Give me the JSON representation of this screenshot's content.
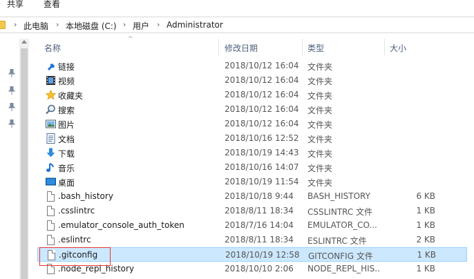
{
  "ribbon": {
    "tabs": [
      "共享",
      "查看"
    ]
  },
  "address": {
    "crumbs": [
      "此电脑",
      "本地磁盘 (C:)",
      "用户",
      "Administrator"
    ]
  },
  "columns": {
    "name": "名称",
    "date": "修改日期",
    "type": "类型",
    "size": "大小"
  },
  "files": [
    {
      "name": "链接",
      "date": "2018/10/12 16:04",
      "type": "文件夹",
      "size": "",
      "icon": "link-folder-icon"
    },
    {
      "name": "视频",
      "date": "2018/10/12 16:04",
      "type": "文件夹",
      "size": "",
      "icon": "video-folder-icon"
    },
    {
      "name": "收藏夹",
      "date": "2018/10/12 16:04",
      "type": "文件夹",
      "size": "",
      "icon": "star-folder-icon"
    },
    {
      "name": "搜索",
      "date": "2018/10/12 16:04",
      "type": "文件夹",
      "size": "",
      "icon": "search-folder-icon"
    },
    {
      "name": "图片",
      "date": "2018/10/12 16:04",
      "type": "文件夹",
      "size": "",
      "icon": "pictures-folder-icon"
    },
    {
      "name": "文档",
      "date": "2018/10/16 12:52",
      "type": "文件夹",
      "size": "",
      "icon": "documents-folder-icon"
    },
    {
      "name": "下载",
      "date": "2018/10/19 14:43",
      "type": "文件夹",
      "size": "",
      "icon": "downloads-folder-icon"
    },
    {
      "name": "音乐",
      "date": "2018/10/16 14:07",
      "type": "文件夹",
      "size": "",
      "icon": "music-folder-icon"
    },
    {
      "name": "桌面",
      "date": "2018/10/19 11:54",
      "type": "文件夹",
      "size": "",
      "icon": "desktop-folder-icon"
    },
    {
      "name": ".bash_history",
      "date": "2018/10/18 9:44",
      "type": "BASH_HISTORY",
      "size": "6 KB",
      "icon": "file-icon"
    },
    {
      "name": ".csslintrc",
      "date": "2018/8/11 18:34",
      "type": "CSSLINTRC 文件",
      "size": "1 KB",
      "icon": "file-icon"
    },
    {
      "name": ".emulator_console_auth_token",
      "date": "2018/7/16 14:04",
      "type": "EMULATOR_CO...",
      "size": "1 KB",
      "icon": "file-icon"
    },
    {
      "name": ".eslintrc",
      "date": "2018/8/11 18:34",
      "type": "ESLINTRC 文件",
      "size": "2 KB",
      "icon": "file-icon"
    },
    {
      "name": ".gitconfig",
      "date": "2018/10/19 12:58",
      "type": "GITCONFIG 文件",
      "size": "1 KB",
      "icon": "file-icon",
      "selected": true
    },
    {
      "name": ".node_repl_history",
      "date": "2018/10/10 2:06",
      "type": "NODE_REPL_HIS...",
      "size": "1 KB",
      "icon": "file-icon"
    }
  ],
  "colors": {
    "selection_bg": "#cce8ff",
    "selection_border": "#99d1ff",
    "annotation": "#e8332d"
  }
}
